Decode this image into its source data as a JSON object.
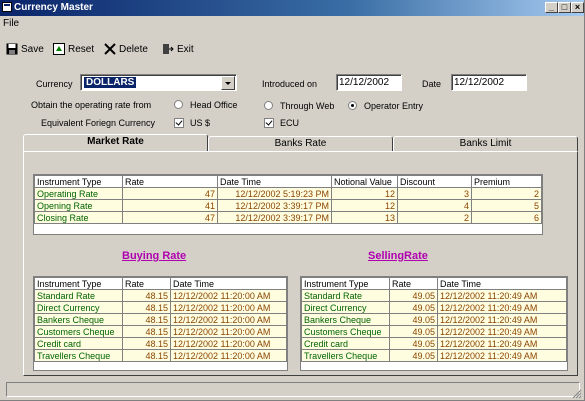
{
  "window": {
    "title": "Currency Master"
  },
  "menu": [
    "File"
  ],
  "toolbar": {
    "save": "Save",
    "reset": "Reset",
    "delete": "Delete",
    "exit": "Exit"
  },
  "form": {
    "currency_label": "Currency",
    "currency_value": "DOLLARS",
    "introduced_label": "Introduced on",
    "introduced_value": "12/12/2002",
    "date_label": "Date",
    "date_value": "12/12/2002",
    "obtain_label": "Obtain the operating rate from",
    "opt_head_office": "Head Office",
    "opt_through_web": "Through Web",
    "opt_operator_entry": "Operator Entry",
    "selected_option": "Operator Entry",
    "equiv_label": "Equivalent Foriegn Currency",
    "chk_us": "US $",
    "chk_ecu": "ECU"
  },
  "tabs": [
    {
      "label": "Market Rate",
      "active": true
    },
    {
      "label": "Banks Rate",
      "active": false
    },
    {
      "label": "Banks Limit",
      "active": false
    }
  ],
  "market": {
    "headers": [
      "Instrument Type",
      "Rate",
      "Date Time",
      "Notional Value",
      "Discount",
      "Premium"
    ],
    "rows": [
      [
        "Operating Rate",
        "47",
        "12/12/2002 5:19:23 PM",
        "12",
        "3",
        "2"
      ],
      [
        "Opening Rate",
        "41",
        "12/12/2002 3:39:17 PM",
        "12",
        "4",
        "5"
      ],
      [
        "Closing Rate",
        "47",
        "12/12/2002 3:39:17 PM",
        "13",
        "2",
        "6"
      ]
    ]
  },
  "buying": {
    "title": "Buying Rate",
    "headers": [
      "Instrument Type",
      "Rate",
      "Date Time"
    ],
    "rows": [
      [
        "Standard Rate",
        "48.15",
        "12/12/2002 11:20:00 AM"
      ],
      [
        "Direct Currency",
        "48.15",
        "12/12/2002 11:20:00 AM"
      ],
      [
        "Bankers Cheque",
        "48.15",
        "12/12/2002 11:20:00 AM"
      ],
      [
        "Customers Cheque",
        "48.15",
        "12/12/2002 11:20:00 AM"
      ],
      [
        "Credit card",
        "48.15",
        "12/12/2002 11:20:00 AM"
      ],
      [
        "Travellers Cheque",
        "48.15",
        "12/12/2002 11:20:00 AM"
      ]
    ]
  },
  "selling": {
    "title": "SellingRate",
    "headers": [
      "Instrument Type",
      "Rate",
      "Date Time"
    ],
    "rows": [
      [
        "Standard Rate",
        "49.05",
        "12/12/2002 11:20:49 AM"
      ],
      [
        "Direct Currency",
        "49.05",
        "12/12/2002 11:20:49 AM"
      ],
      [
        "Bankers Cheque",
        "49.05",
        "12/12/2002 11:20:49 AM"
      ],
      [
        "Customers Cheque",
        "49.05",
        "12/12/2002 11:20:49 AM"
      ],
      [
        "Credit card",
        "49.05",
        "12/12/2002 11:20:49 AM"
      ],
      [
        "Travellers Cheque",
        "49.05",
        "12/12/2002 11:20:49 AM"
      ]
    ]
  },
  "colors": {
    "title_bar": "#0a246a",
    "accent_title": "#b000b0",
    "cell_text": "#8b4500",
    "name_text": "#006400",
    "cell_bg": "#fffde0"
  }
}
